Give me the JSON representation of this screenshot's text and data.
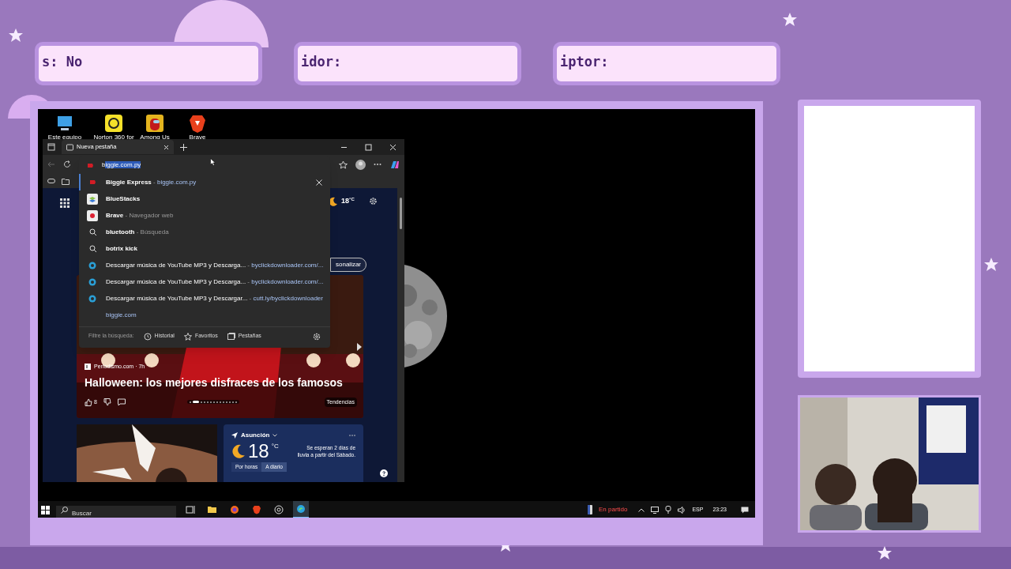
{
  "overlay": {
    "info_boxes": [
      {
        "text": "s: No"
      },
      {
        "text": "idor:"
      },
      {
        "text": "iptor:"
      }
    ]
  },
  "desktop_icons": [
    {
      "label": "Este equipo",
      "kind": "computer"
    },
    {
      "label": "Norton 360 for",
      "kind": "norton"
    },
    {
      "label": "Among Us",
      "kind": "game"
    },
    {
      "label": "Brave",
      "kind": "brave"
    }
  ],
  "browser": {
    "tab": {
      "title": "Nueva pestaña"
    },
    "address": {
      "typed": "b",
      "completion": "iggie.com.py"
    },
    "suggestions": [
      {
        "kind": "favicon",
        "title": "Biggie Express",
        "separator": "-",
        "subtitle": "biggie.com.py",
        "removable": true
      },
      {
        "kind": "stack",
        "title": "BlueStacks",
        "removable": false
      },
      {
        "kind": "browser",
        "title": "Brave",
        "separator": "-",
        "subtitle": "Navegador web",
        "removable": false
      },
      {
        "kind": "search",
        "title": "bluetooth",
        "separator": "-",
        "subtitle": "Búsqueda",
        "removable": false
      },
      {
        "kind": "search",
        "title": "botrix kick",
        "removable": false
      },
      {
        "kind": "link",
        "title": "Descargar música de YouTube MP3 y Descarga...",
        "separator": "-",
        "subtitle": "byclickdownloader.com/...",
        "removable": false
      },
      {
        "kind": "link",
        "title": "Descargar música de YouTube MP3 y Descarga...",
        "separator": "-",
        "subtitle": "byclickdownloader.com/...",
        "removable": false
      },
      {
        "kind": "link",
        "title": "Descargar música de YouTube MP3 y Descargar...",
        "separator": "-",
        "subtitle": "cutt.ly/byclickdownloader",
        "removable": false
      },
      {
        "kind": "plain",
        "title": "biggie.com",
        "removable": false
      }
    ],
    "filter": {
      "label": "Filtre la búsqueda:",
      "buttons": [
        {
          "kind": "history",
          "label": "Historial"
        },
        {
          "kind": "star",
          "label": "Favoritos"
        },
        {
          "kind": "tabs",
          "label": "Pestañas"
        }
      ]
    },
    "page": {
      "weather_temp": "18",
      "weather_unit": "°C",
      "customize": "sonalizar",
      "news": {
        "source": "Periodismo.com · 7h",
        "headline": "Halloween: los mejores disfraces de los famosos",
        "likes": "8",
        "trending": "Tendencias",
        "carousel": [
          {
            "selected": false
          },
          {
            "selected": true
          },
          {
            "selected": false
          },
          {
            "selected": false
          },
          {
            "selected": false
          },
          {
            "selected": false
          },
          {
            "selected": false
          },
          {
            "selected": false
          },
          {
            "selected": false
          },
          {
            "selected": false
          },
          {
            "selected": false
          },
          {
            "selected": false
          },
          {
            "selected": false
          },
          {
            "selected": false
          }
        ]
      },
      "weather_card": {
        "city": "Asunción",
        "temp": "18",
        "unit": "°C",
        "forecast": "Se esperan 2 días de lluvia a partir del Sábado.",
        "tabs": [
          {
            "label": "Por horas",
            "selected": false
          },
          {
            "label": "A diario",
            "selected": true
          }
        ]
      }
    }
  },
  "taskbar": {
    "search_placeholder": "Buscar",
    "apps": [
      {
        "kind": "taskview",
        "active": false
      },
      {
        "kind": "files",
        "active": false
      },
      {
        "kind": "firefox",
        "active": false
      },
      {
        "kind": "brave",
        "active": false
      },
      {
        "kind": "chrome",
        "active": false
      },
      {
        "kind": "edge",
        "active": true
      }
    ],
    "game_status": "En partido",
    "language": "ESP",
    "time": "23:23"
  }
}
